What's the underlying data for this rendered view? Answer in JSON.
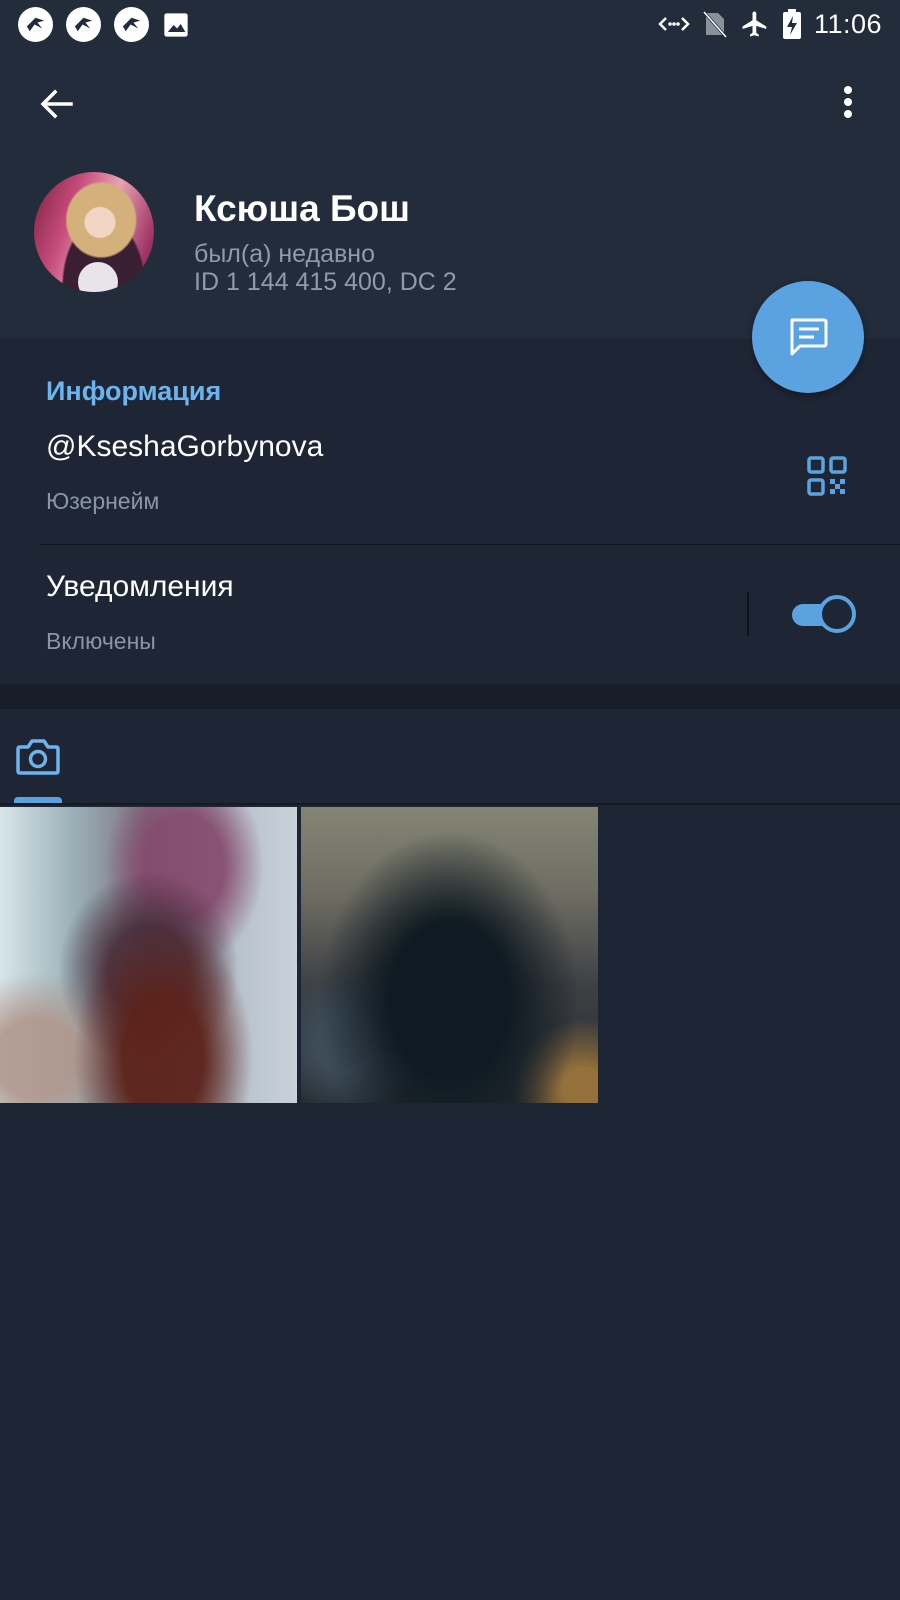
{
  "status_bar": {
    "time": "11:06",
    "left_icons": [
      "app-notification-icon",
      "app-notification-icon",
      "app-notification-icon",
      "image-icon"
    ],
    "right_icons": [
      "data-saver-icon",
      "no-sim-icon",
      "airplane-mode-icon",
      "battery-charging-icon"
    ]
  },
  "profile": {
    "name": "Ксюша Бош",
    "status": "был(а) недавно",
    "id_line": "ID 1 144 415 400, DC 2"
  },
  "info": {
    "heading": "Информация",
    "username": "@KseshaGorbynova",
    "username_caption": "Юзернейм",
    "notifications_label": "Уведомления",
    "notifications_caption": "Включены",
    "notifications_enabled": true
  },
  "media": {
    "active_tab_icon": "camera-icon",
    "items_count": 2
  },
  "colors": {
    "background": "#1d2433",
    "header": "#222c3b",
    "accent": "#5aa3e0",
    "section_heading": "#6db3ee",
    "secondary_text": "#8b96a4"
  }
}
